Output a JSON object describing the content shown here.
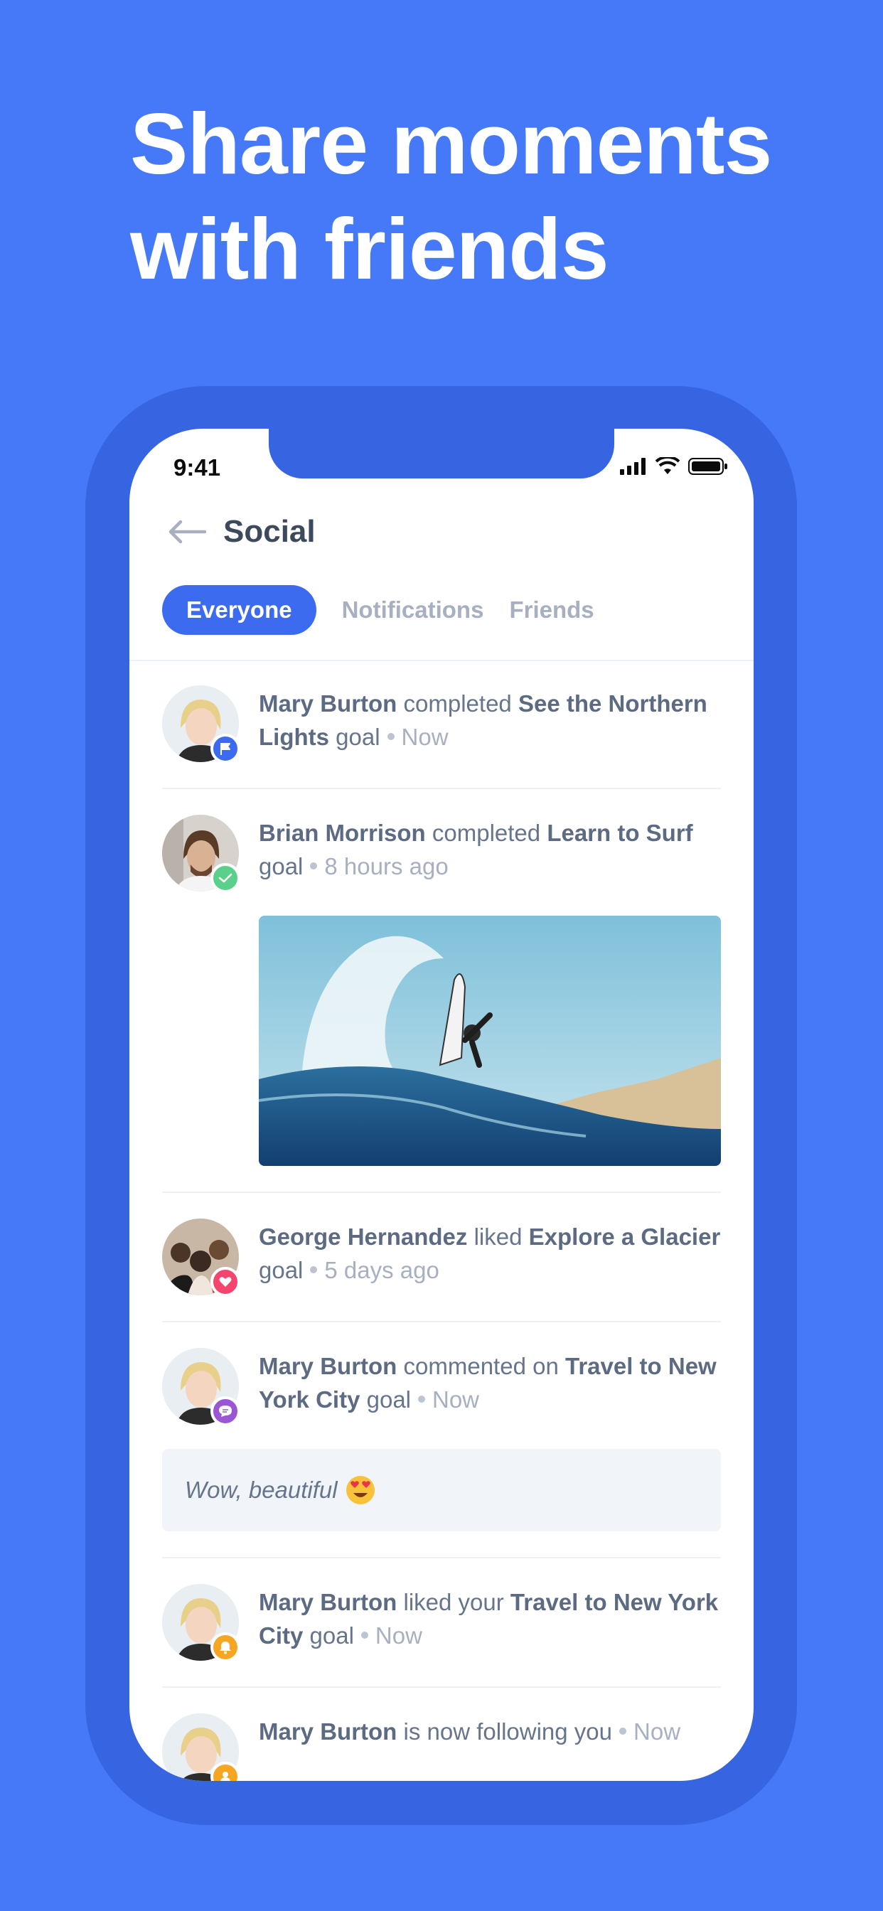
{
  "hero": {
    "line1": "Share moments",
    "line2": "with friends"
  },
  "status_bar": {
    "time": "9:41"
  },
  "header": {
    "title": "Social"
  },
  "tabs": [
    {
      "label": "Everyone",
      "active": true
    },
    {
      "label": "Notifications",
      "active": false
    },
    {
      "label": "Friends",
      "active": false
    }
  ],
  "feed": [
    {
      "user": "Mary Burton",
      "action": "completed",
      "target": "See the Northern Lights",
      "suffix": "goal",
      "time": "Now",
      "badge": "flag-icon",
      "badge_color": "#3c6bf0"
    },
    {
      "user": "Brian Morrison",
      "action": "completed",
      "target": "Learn to Surf",
      "suffix": "goal",
      "time": "8 hours ago",
      "badge": "check-icon",
      "badge_color": "#5bd08a"
    },
    {
      "user": "George Hernandez",
      "action": "liked",
      "target": "Explore a Glacier",
      "suffix": "goal",
      "time": "5 days ago",
      "badge": "heart-icon",
      "badge_color": "#f5456f"
    },
    {
      "user": "Mary Burton",
      "action": "commented on",
      "target": "Travel to New York City",
      "suffix": "goal",
      "time": "Now",
      "badge": "chat-icon",
      "badge_color": "#9b56d6",
      "comment": "Wow, beautiful"
    },
    {
      "user": "Mary Burton",
      "action": "liked your",
      "target": "Travel to New York City",
      "suffix": "goal",
      "time": "Now",
      "badge": "bell-icon",
      "badge_color": "#f5a623"
    },
    {
      "user": "Mary Burton",
      "action": "is now following you",
      "time": "Now",
      "badge": "person-icon",
      "badge_color": "#f5a623"
    }
  ]
}
